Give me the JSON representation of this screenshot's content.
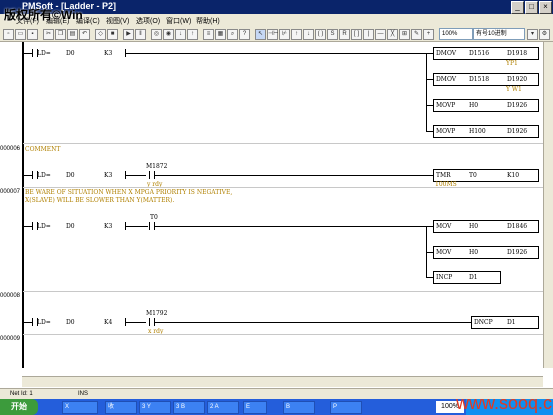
{
  "watermark": "版权所有©Win",
  "window": {
    "title": "PMSoft - [Ladder - P2]",
    "min": "_",
    "max": "□",
    "close": "×"
  },
  "menu": [
    "文件(F)",
    "编辑(E)",
    "编译(C)",
    "视图(V)",
    "选项(O)",
    "窗口(W)",
    "帮助(H)"
  ],
  "toolbar": {
    "zoom": "100%",
    "format": "有号10进制"
  },
  "rungs": [
    {
      "num": "",
      "contacts": [
        {
          "type": "LD=",
          "a": "D0",
          "b": "K3"
        }
      ],
      "outputs": [
        {
          "op": "DMOV",
          "a": "D1516",
          "b": "D1918",
          "sub": "YP1"
        },
        {
          "op": "DMOV",
          "a": "D1518",
          "b": "D1920",
          "sub": "Y W1"
        },
        {
          "op": "MOVP",
          "a": "H0",
          "b": "D1926",
          "sub": ""
        },
        {
          "op": "MOVP",
          "a": "H100",
          "b": "D1926",
          "sub": ""
        }
      ]
    },
    {
      "num": "000006",
      "comment": "COMMENT",
      "contacts": [
        {
          "type": "LD=",
          "a": "D0",
          "b": "K3"
        }
      ],
      "contact2": {
        "label": "M1872",
        "sub": "y rdy"
      },
      "outputs": [
        {
          "op": "TMR",
          "a": "T0",
          "b": "K10",
          "sub": "100MS"
        }
      ]
    },
    {
      "num": "000007",
      "comment": "BE WARE OF SITUATION WHEN X MPGA PRIORITY IS NEGATIVE,",
      "comment2": "X(SLAVE) WILL BE SLOWER THAN Y(MATTER).",
      "contacts": [
        {
          "type": "LD=",
          "a": "D0",
          "b": "K3"
        }
      ],
      "contact2": {
        "label": "T0",
        "sub": ""
      },
      "outputs": [
        {
          "op": "MOV",
          "a": "H0",
          "b": "D1846",
          "sub": ""
        },
        {
          "op": "MOV",
          "a": "H0",
          "b": "D1926",
          "sub": ""
        },
        {
          "op": "INCP",
          "a": "D1",
          "b": "",
          "sub": ""
        }
      ]
    },
    {
      "num": "000008",
      "contacts": [
        {
          "type": "LD=",
          "a": "D0",
          "b": "K4"
        }
      ],
      "contact2": {
        "label": "M1792",
        "sub": "x rdy"
      },
      "outputs": [
        {
          "op": "DNCP",
          "a": "D1",
          "b": "",
          "sub": ""
        }
      ]
    },
    {
      "num": "000009"
    }
  ],
  "status": {
    "net": "Net Id: 1",
    "mode": "INS"
  },
  "taskbar": {
    "start": "开始",
    "items": [
      "X",
      "收",
      "3 Y",
      "3 B",
      "2 A",
      "E",
      "B",
      "P"
    ],
    "zoom": "100%"
  },
  "site": "www.sooq.cn"
}
